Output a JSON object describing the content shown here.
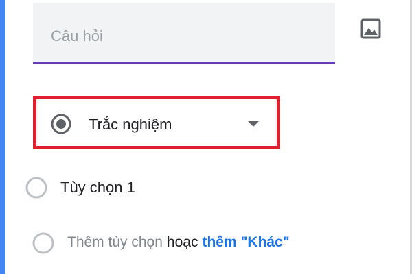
{
  "question": {
    "placeholder": "Câu hỏi",
    "value": ""
  },
  "image_button": {
    "icon": "image-icon"
  },
  "question_type": {
    "label": "Trắc nghiệm",
    "icon": "radio-button-checked-icon",
    "arrow_icon": "arrow-drop-down-icon",
    "highlight_color": "#e0202e"
  },
  "options": [
    {
      "label": "Tùy chọn 1"
    }
  ],
  "add_option": {
    "label": "Thêm tùy chọn",
    "or": "hoạc",
    "other_label": "thêm \"Khác\""
  },
  "colors": {
    "accent_blue": "#4285f4",
    "underline_purple": "#673ab7",
    "link_blue": "#1a73e8"
  }
}
